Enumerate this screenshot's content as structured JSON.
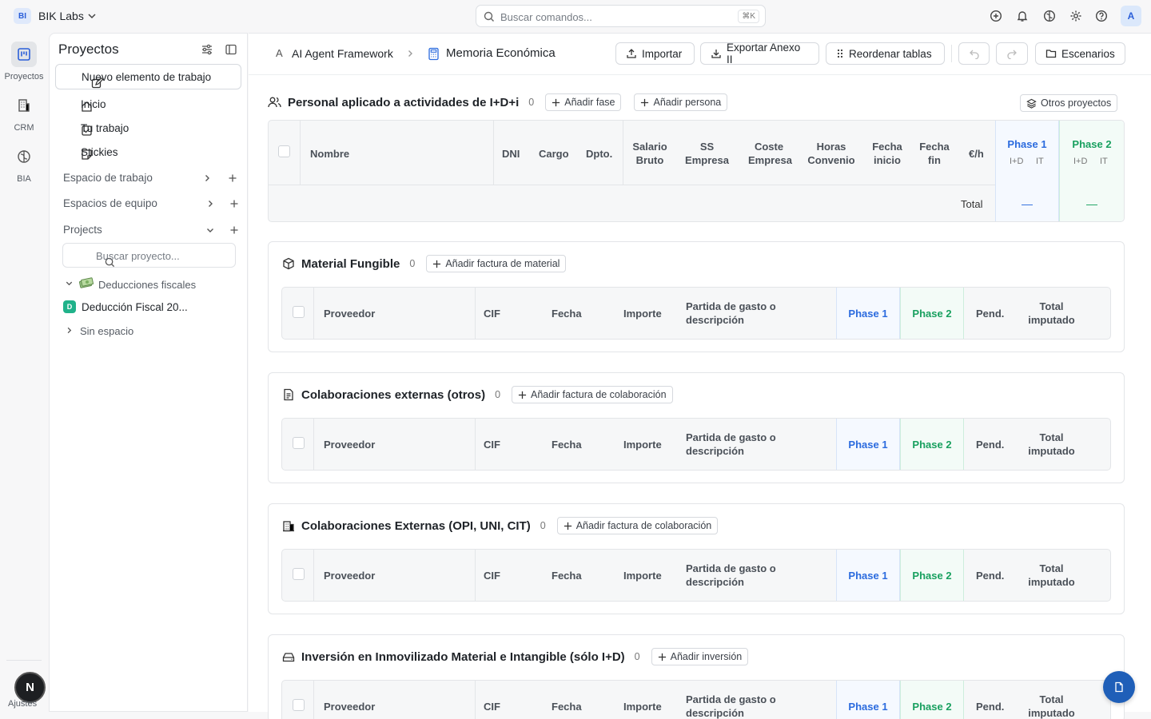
{
  "topbar": {
    "workspace_badge": "BI",
    "workspace_name": "BIK Labs",
    "command_placeholder": "Buscar comandos...",
    "command_shortcut": "⌘K",
    "user_initial": "A"
  },
  "rail": {
    "items": [
      {
        "label": "Proyectos",
        "icon": "kanban-icon"
      },
      {
        "label": "CRM",
        "icon": "building-icon"
      },
      {
        "label": "BIA",
        "icon": "brain-icon"
      }
    ],
    "user_initial": "N",
    "settings_label": "Ajustes"
  },
  "sidebar": {
    "title": "Proyectos",
    "new_item_label": "Nuevo elemento de trabajo",
    "nav": [
      "Inicio",
      "Tu trabajo",
      "Stickies"
    ],
    "groups": [
      "Espacio de trabajo",
      "Espacios de equipo",
      "Projects"
    ],
    "project_search_placeholder": "Buscar proyecto...",
    "tree": {
      "folder": "Deducciones fiscales",
      "project_badge": "D",
      "project": "Deducción Fiscal 20...",
      "no_space": "Sin espacio"
    }
  },
  "header": {
    "breadcrumb_prefix": "A",
    "breadcrumb_project": "AI Agent Framework",
    "breadcrumb_page": "Memoria Económica",
    "import_label": "Importar",
    "export_label": "Exportar Anexo II",
    "reorder_label": "Reordenar tablas",
    "scenarios_label": "Escenarios"
  },
  "personal": {
    "title": "Personal aplicado a actividades de I+D+i",
    "count": "0",
    "add_phase": "Añadir fase",
    "add_person": "Añadir persona",
    "other_projects": "Otros proyectos",
    "columns": [
      "Nombre",
      "DNI",
      "Cargo",
      "Dpto.",
      "Salario Bruto",
      "SS Empresa",
      "Coste Empresa",
      "Horas Convenio",
      "Fecha inicio",
      "Fecha fin",
      "€/h"
    ],
    "phase1": "Phase 1",
    "phase2": "Phase 2",
    "sub_id": "I+D",
    "sub_it": "IT",
    "total_label": "Total",
    "total_phase1": "—",
    "total_phase2": "—"
  },
  "invoice_columns": {
    "provider": "Proveedor",
    "cif": "CIF",
    "date": "Fecha",
    "amount": "Importe",
    "item": "Partida de gasto o descripción",
    "phase1": "Phase 1",
    "phase2": "Phase 2",
    "pending": "Pend.",
    "total": "Total imputado"
  },
  "sections": [
    {
      "title": "Material Fungible",
      "count": "0",
      "action": "Añadir factura de material",
      "icon": "box-icon"
    },
    {
      "title": "Colaboraciones externas (otros)",
      "count": "0",
      "action": "Añadir factura de colaboración",
      "icon": "document-icon"
    },
    {
      "title": "Colaboraciones Externas (OPI, UNI, CIT)",
      "count": "0",
      "action": "Añadir factura de colaboración",
      "icon": "institution-icon"
    },
    {
      "title": "Inversión en Inmovilizado Material e Intangible (sólo I+D)",
      "count": "0",
      "action": "Añadir inversión",
      "icon": "drive-icon"
    }
  ],
  "colors": {
    "phase1": "#2b6bde",
    "phase2": "#18a05f",
    "accent": "#1f5fb8"
  }
}
